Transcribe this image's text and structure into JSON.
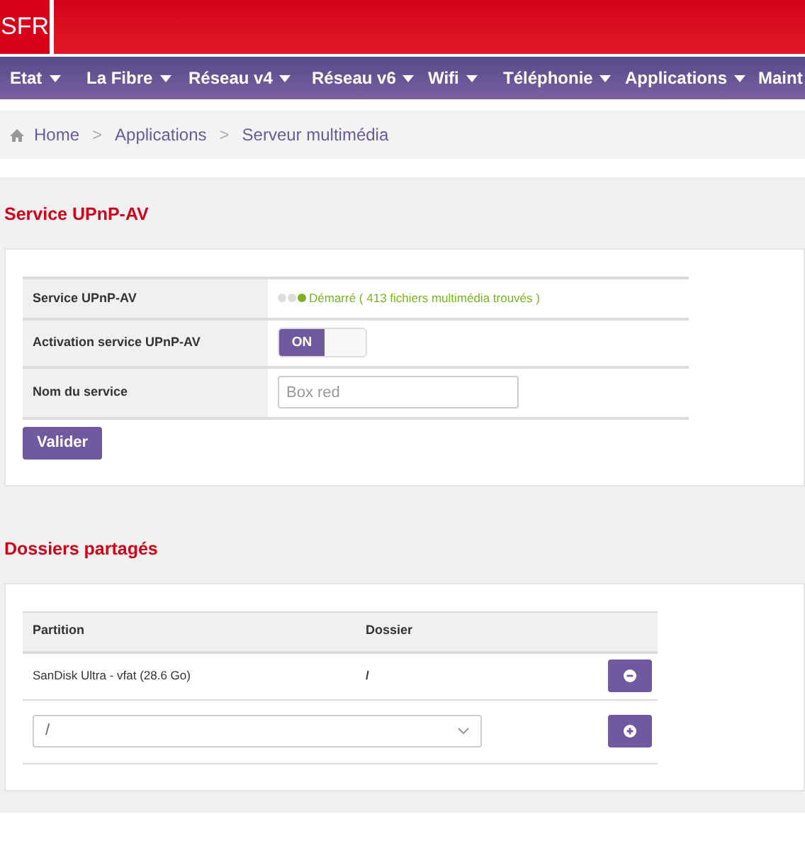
{
  "header": {
    "logo": "SFR"
  },
  "nav": [
    {
      "label": "Etat"
    },
    {
      "label": "La Fibre"
    },
    {
      "label": "Réseau v4"
    },
    {
      "label": "Réseau v6"
    },
    {
      "label": "Wifi"
    },
    {
      "label": "Téléphonie"
    },
    {
      "label": "Applications"
    },
    {
      "label": "Maint"
    }
  ],
  "breadcrumb": [
    {
      "label": "Home"
    },
    {
      "separator": ">",
      "label": "Applications"
    },
    {
      "separator": ">",
      "label": "Serveur multimédia"
    }
  ],
  "upnp": {
    "title": "Service UPnP-AV",
    "rows": [
      {
        "kind": "status",
        "label": "Service UPnP-AV",
        "text": "Démarré ( 413 fichiers multimédia trouvés )",
        "active": true
      },
      {
        "kind": "toggle",
        "label": "Activation service UPnP-AV",
        "toggle_label": "ON",
        "on": true
      },
      {
        "kind": "input",
        "label": "Nom du service",
        "placeholder": "Box red"
      }
    ],
    "button": "Valider"
  },
  "shares": {
    "title": "Dossiers partagés",
    "columns": [
      "Partition",
      "Dossier"
    ],
    "rows": [
      {
        "partition": "SanDisk Ultra - vfat (28.6 Go)",
        "folder": "/"
      }
    ],
    "new_row": {
      "value": "/"
    }
  }
}
